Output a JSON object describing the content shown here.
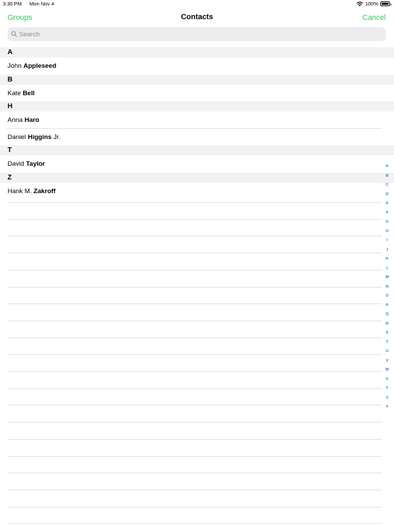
{
  "status_bar": {
    "time": "3:30 PM",
    "date": "Mon Nov 4",
    "battery": "100%"
  },
  "navbar": {
    "left_button": "Groups",
    "title": "Contacts",
    "right_button": "Cancel"
  },
  "search": {
    "placeholder": "Search"
  },
  "sections": [
    {
      "letter": "A",
      "contacts": [
        {
          "first": "John",
          "last": "Appleseed",
          "suffix": ""
        }
      ]
    },
    {
      "letter": "B",
      "contacts": [
        {
          "first": "Kate",
          "last": "Bell",
          "suffix": ""
        }
      ]
    },
    {
      "letter": "H",
      "contacts": [
        {
          "first": "Anna",
          "last": "Haro",
          "suffix": ""
        },
        {
          "first": "Daniel",
          "last": "Higgins",
          "suffix": "Jr."
        }
      ]
    },
    {
      "letter": "T",
      "contacts": [
        {
          "first": "David",
          "last": "Taylor",
          "suffix": ""
        }
      ]
    },
    {
      "letter": "Z",
      "contacts": [
        {
          "first": "Hank M.",
          "last": "Zakroff",
          "suffix": ""
        }
      ]
    }
  ],
  "index_letters": [
    "A",
    "B",
    "C",
    "D",
    "E",
    "F",
    "G",
    "H",
    "I",
    "J",
    "K",
    "L",
    "M",
    "N",
    "O",
    "P",
    "Q",
    "R",
    "S",
    "T",
    "U",
    "V",
    "W",
    "X",
    "Y",
    "Z",
    "#"
  ],
  "colors": {
    "accent": "#34c759",
    "index": "#2f7de1",
    "section_bg": "#f2f2f4"
  }
}
